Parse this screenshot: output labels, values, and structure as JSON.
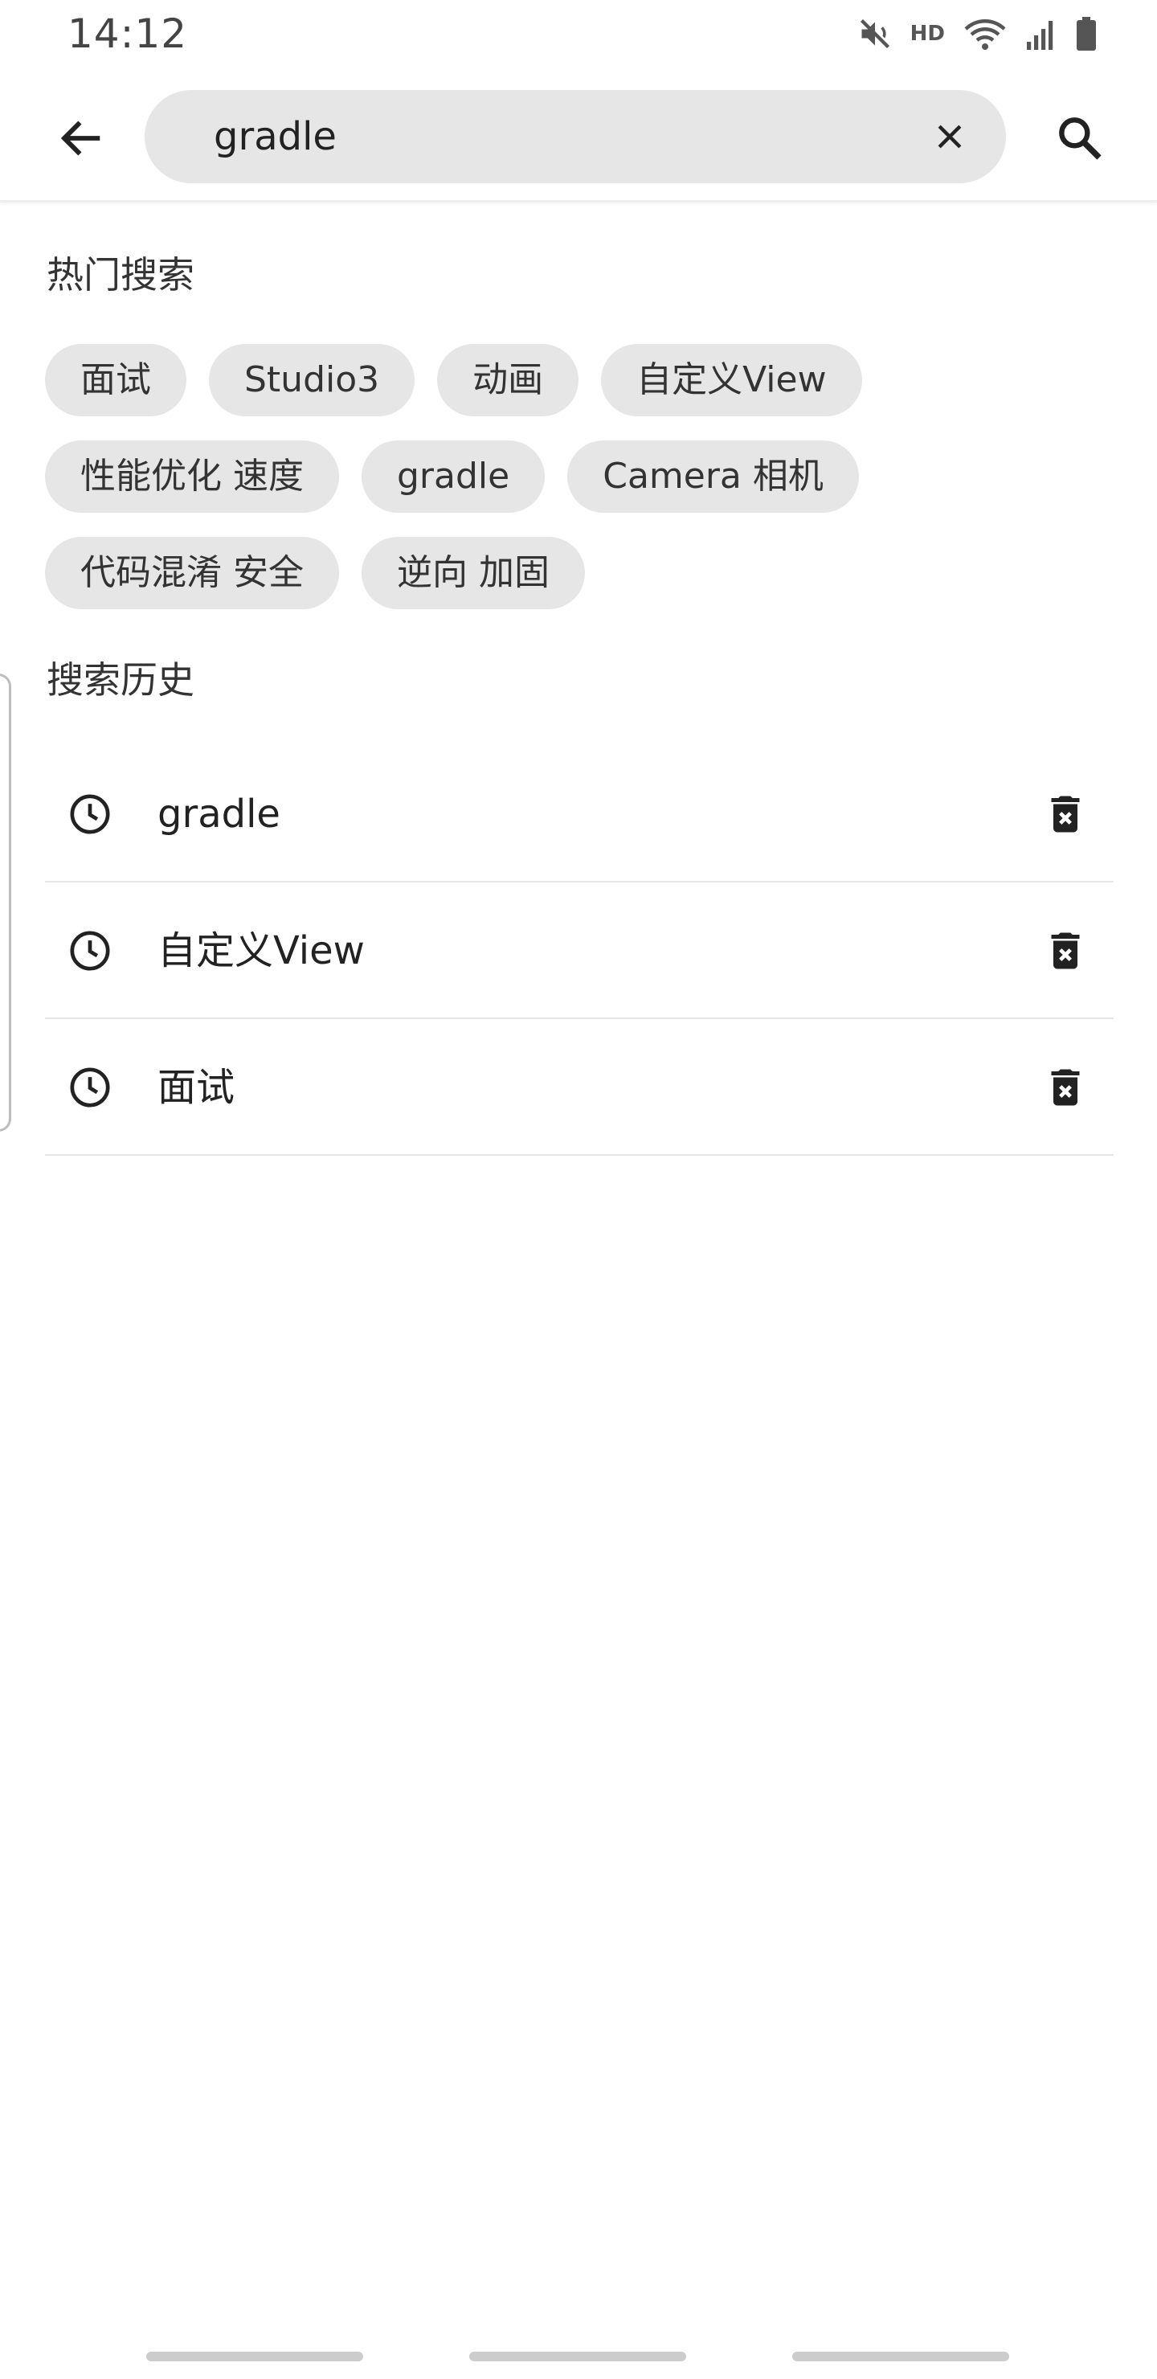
{
  "status_bar": {
    "time": "14:12",
    "hd_label": "HD",
    "icons": [
      "mute-icon",
      "wifi-icon",
      "signal-icon",
      "battery-icon"
    ]
  },
  "search": {
    "value": "gradle",
    "placeholder": ""
  },
  "hot_search": {
    "title": "热门搜索",
    "rows": [
      [
        "面试",
        "Studio3",
        "动画",
        "自定义View"
      ],
      [
        "性能优化 速度",
        "gradle",
        "Camera 相机"
      ],
      [
        "代码混淆 安全",
        "逆向 加固"
      ]
    ]
  },
  "history": {
    "title": "搜索历史",
    "items": [
      "gradle",
      "自定义View",
      "面试"
    ]
  },
  "colors": {
    "chip_bg": "#e6e6e6",
    "search_bg": "#e6e6e6",
    "divider": "#e5e5e5",
    "text": "#222222"
  }
}
